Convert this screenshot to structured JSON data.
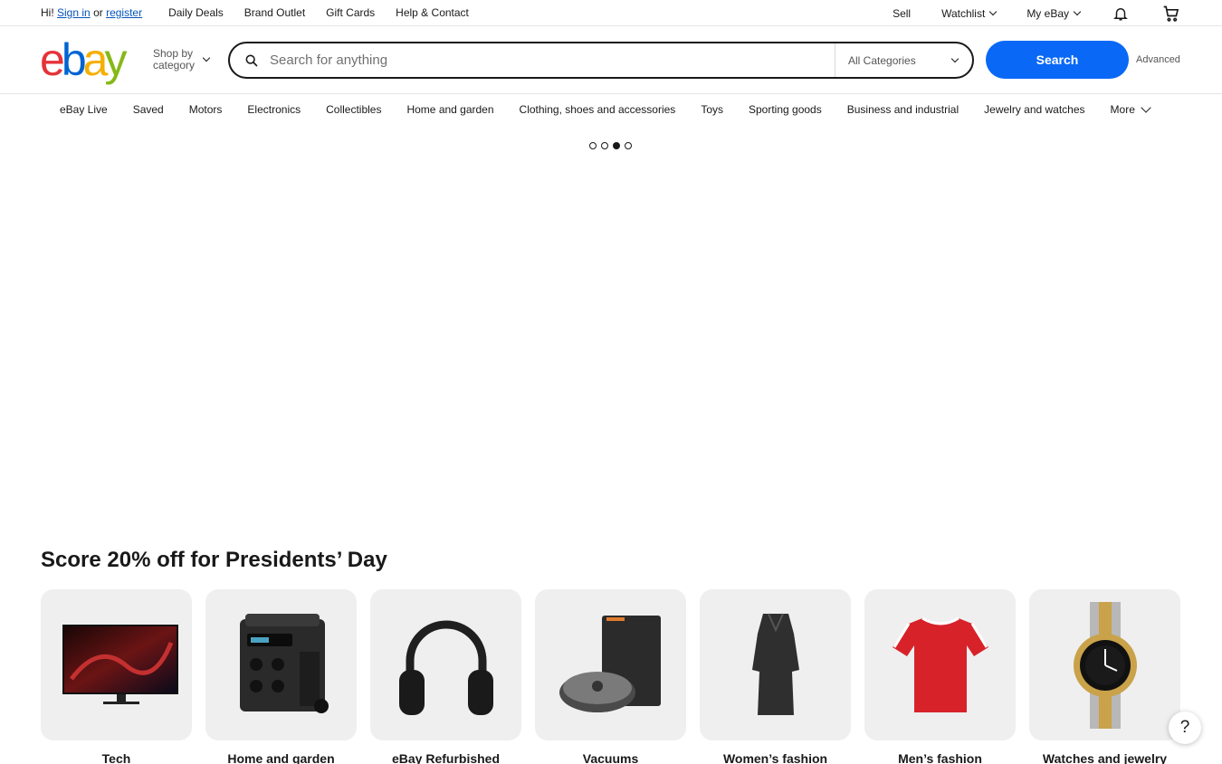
{
  "topbar": {
    "greeting_prefix": "Hi!",
    "sign_in": "Sign in",
    "or": "or",
    "register": "register",
    "links": [
      "Daily Deals",
      "Brand Outlet",
      "Gift Cards",
      "Help & Contact"
    ],
    "sell": "Sell",
    "watchlist": "Watchlist",
    "my_ebay": "My eBay"
  },
  "header": {
    "logo_letters": [
      "e",
      "b",
      "a",
      "y"
    ],
    "logo_colors": [
      "#e53238",
      "#0064d2",
      "#f5af02",
      "#86b817"
    ],
    "shop_by_line1": "Shop by",
    "shop_by_line2": "category",
    "search_placeholder": "Search for anything",
    "category_select": "All Categories",
    "search_button": "Search",
    "advanced": "Advanced"
  },
  "catnav": [
    "eBay Live",
    "Saved",
    "Motors",
    "Electronics",
    "Collectibles",
    "Home and garden",
    "Clothing, shoes and accessories",
    "Toys",
    "Sporting goods",
    "Business and industrial",
    "Jewelry and watches",
    "More"
  ],
  "carousel": {
    "slides": 4,
    "active_index": 2
  },
  "promo": {
    "title": "Score 20% off for Presidents’ Day",
    "tiles": [
      {
        "label": "Tech",
        "icon": "tv-icon"
      },
      {
        "label": "Home and garden",
        "icon": "power-station-icon"
      },
      {
        "label": "eBay Refurbished",
        "icon": "headphones-icon"
      },
      {
        "label": "Vacuums",
        "icon": "robot-vacuum-icon"
      },
      {
        "label": "Women’s fashion",
        "icon": "dress-icon"
      },
      {
        "label": "Men’s fashion",
        "icon": "tshirt-icon"
      },
      {
        "label": "Watches and jewelry",
        "icon": "watch-icon"
      }
    ]
  },
  "help": "?"
}
